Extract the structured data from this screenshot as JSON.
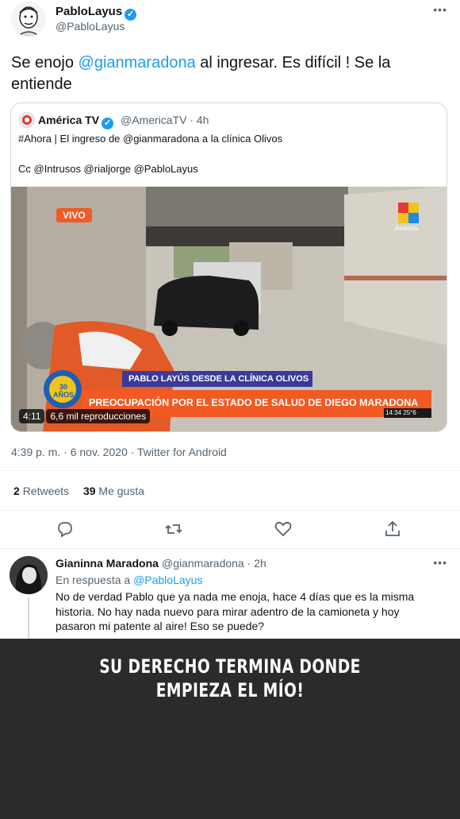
{
  "tweet": {
    "author_name": "PabloLayus",
    "author_handle": "@PabloLayus",
    "more_icon": "more-dots-icon",
    "text_before": "Se enojo ",
    "text_mention": "@gianmaradona",
    "text_after": " al ingresar. Es difícil ! Se la entiende",
    "timestamp": "4:39 p. m. · 6 nov. 2020 · Twitter for Android",
    "retweets_count": "2",
    "retweets_label": "Retweets",
    "likes_count": "39",
    "likes_label": "Me gusta"
  },
  "quote": {
    "author_name": "América TV",
    "meta": "@AmericaTV · 4h",
    "line1": "#Ahora | El ingreso de @gianmaradona a la clínica Olivos",
    "line2": "Cc @Intrusos @rialjorge @PabloLayus",
    "video": {
      "live_label": "VIVO",
      "lower_third_top": "PABLO LAYÚS DESDE LA CLÍNICA OLIVOS",
      "lower_third_main": "PREOCUPACIÓN POR EL ESTADO DE SALUD DE DIEGO MARADONA",
      "clock": "14:34  25°6",
      "duration": "4:11",
      "views": "6,6 mil reproducciones",
      "channel_bug": "América",
      "anniversary_logo": "30 AÑOS"
    }
  },
  "actions": [
    "reply-icon",
    "retweet-icon",
    "like-icon",
    "share-icon"
  ],
  "reply": {
    "author_name": "Gianinna Maradona",
    "meta": "@gianmaradona · 2h",
    "reply_prefix": "En respuesta a ",
    "reply_to": "@PabloLayus",
    "body": "No de verdad Pablo que ya nada me enoja, hace 4 días que es la misma historia. No hay nada nuevo para mirar adentro de la camioneta y hoy pasaron mi patente al aire! Eso se puede?"
  },
  "story": {
    "line1": "SU DERECHO TERMINA DONDE",
    "line2": "EMPIEZA EL MÍO!"
  },
  "colors": {
    "accent": "#1d9bf0",
    "text": "#0f1419",
    "muted": "#536471",
    "story_bg": "#2b2b2b",
    "tv_orange": "#f15a22"
  }
}
